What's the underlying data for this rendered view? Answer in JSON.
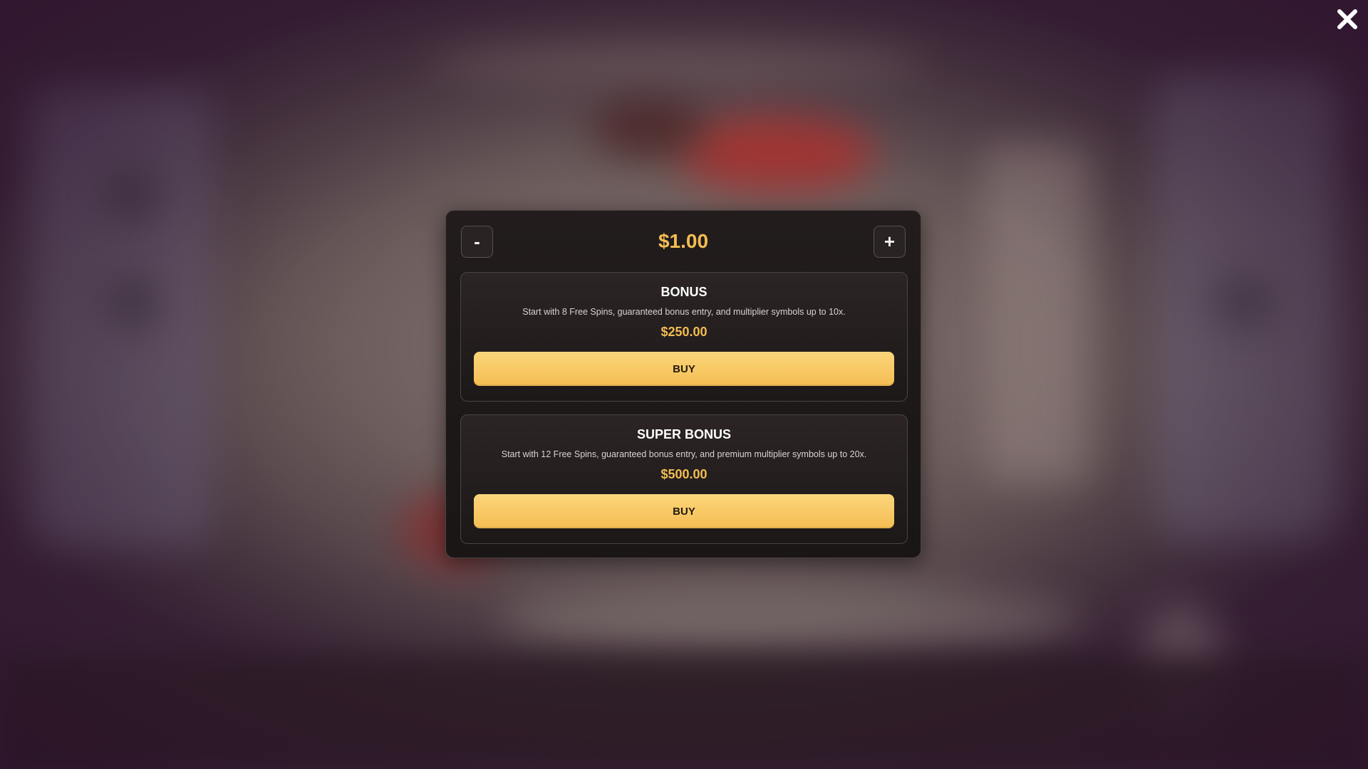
{
  "bet": {
    "decrease_label": "-",
    "increase_label": "+",
    "value": "$1.00"
  },
  "offers": [
    {
      "title": "BONUS",
      "description": "Start with 8 Free Spins, guaranteed bonus entry, and multiplier symbols up to 10x.",
      "price": "$250.00",
      "button_label": "BUY"
    },
    {
      "title": "SUPER BONUS",
      "description": "Start with 12 Free Spins, guaranteed bonus entry, and premium multiplier symbols up to 20x.",
      "price": "$500.00",
      "button_label": "BUY"
    }
  ],
  "icons": {
    "close": "close-icon"
  },
  "colors": {
    "accent_gold": "#f2bd52",
    "button_gold": "#f4bd52",
    "modal_bg": "#1e1919"
  }
}
